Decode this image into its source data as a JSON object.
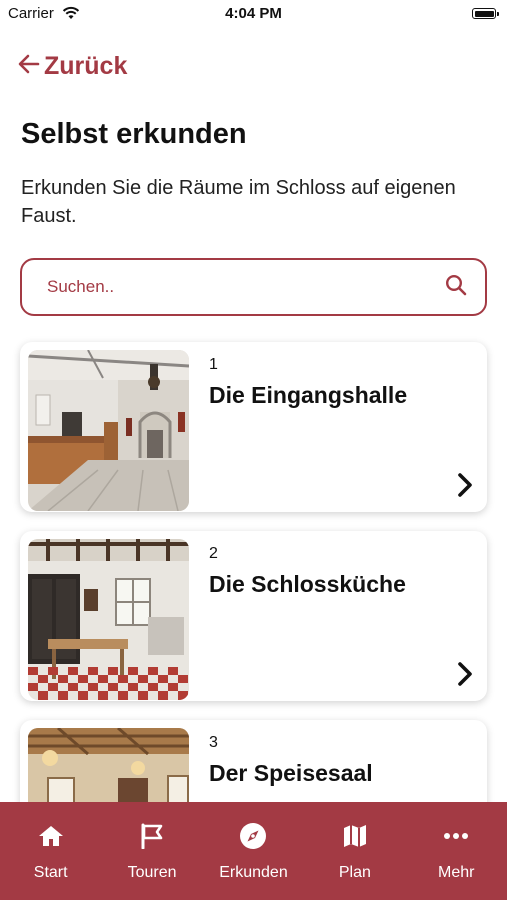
{
  "status_bar": {
    "carrier": "Carrier",
    "time": "4:04 PM"
  },
  "header": {
    "back_label": "Zurück"
  },
  "page": {
    "title": "Selbst erkunden",
    "subtitle": "Erkunden Sie die Räume im Schloss auf eigenen Faust."
  },
  "search": {
    "placeholder": "Suchen.."
  },
  "rooms": [
    {
      "number": "1",
      "name": "Die Eingangshalle"
    },
    {
      "number": "2",
      "name": "Die Schlossküche"
    },
    {
      "number": "3",
      "name": "Der Speisesaal"
    }
  ],
  "tab_bar": {
    "items": [
      {
        "label": "Start",
        "icon": "home-icon"
      },
      {
        "label": "Touren",
        "icon": "flag-icon"
      },
      {
        "label": "Erkunden",
        "icon": "compass-icon"
      },
      {
        "label": "Plan",
        "icon": "map-icon"
      },
      {
        "label": "Mehr",
        "icon": "more-icon"
      }
    ]
  },
  "colors": {
    "accent": "#a33a44",
    "background": "#ffffff",
    "text": "#111111"
  }
}
